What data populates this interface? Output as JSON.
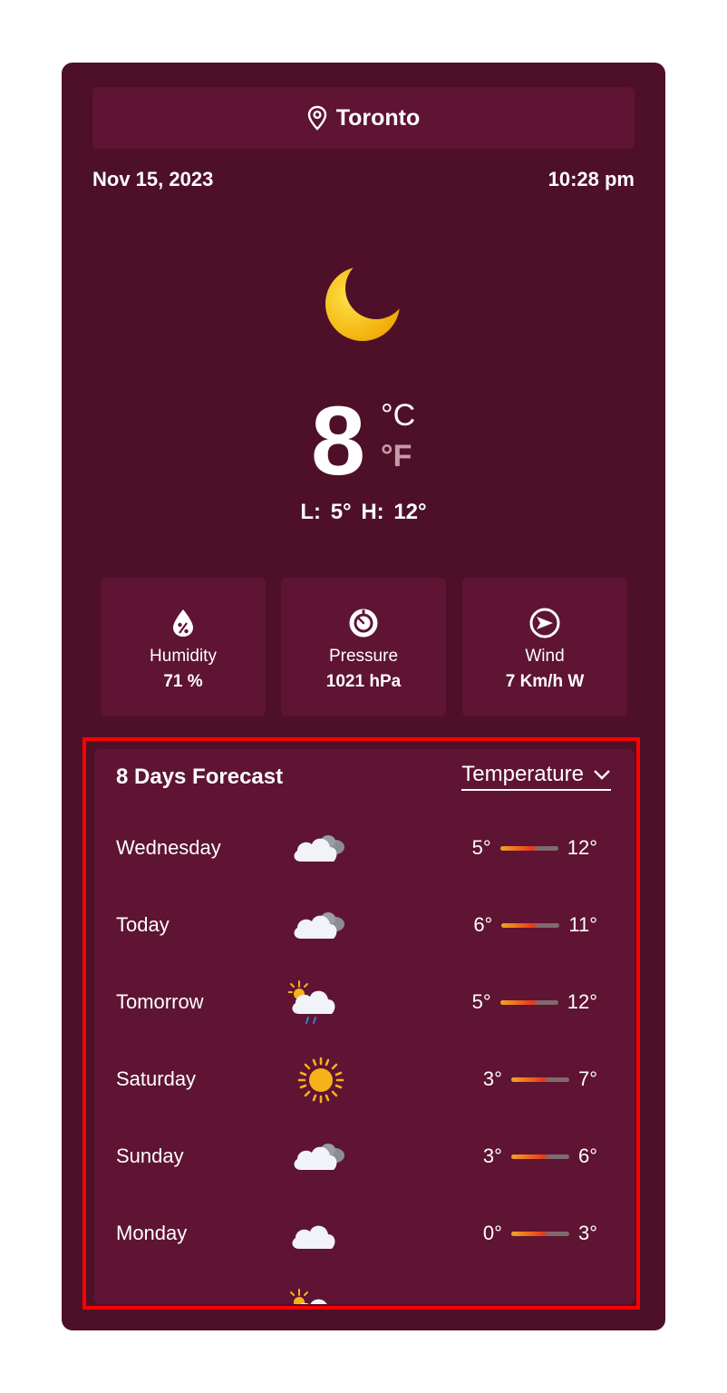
{
  "location": {
    "city": "Toronto",
    "icon": "map-pin-icon"
  },
  "date": "Nov 15, 2023",
  "time": "10:28 pm",
  "current": {
    "icon": "moon-icon",
    "temperature": "8",
    "unit_c": "°C",
    "unit_f": "°F",
    "low_high": "L: 5°  H: 12°"
  },
  "stats": [
    {
      "label": "Humidity",
      "value": "71 %",
      "icon": "humidity-drop-icon"
    },
    {
      "label": "Pressure",
      "value": "1021 hPa",
      "icon": "pressure-gauge-icon"
    },
    {
      "label": "Wind",
      "value": "7 Km/h W",
      "icon": "wind-direction-icon"
    }
  ],
  "forecast": {
    "title": "8 Days Forecast",
    "metric": "Temperature",
    "days": [
      {
        "day": "Wednesday",
        "icon": "cloud-icon",
        "low": "5°",
        "high": "12°"
      },
      {
        "day": "Today",
        "icon": "cloud-icon",
        "low": "6°",
        "high": "11°"
      },
      {
        "day": "Tomorrow",
        "icon": "sun-cloud-rain-icon",
        "low": "5°",
        "high": "12°"
      },
      {
        "day": "Saturday",
        "icon": "sun-icon",
        "low": "3°",
        "high": "7°"
      },
      {
        "day": "Sunday",
        "icon": "cloud-icon",
        "low": "3°",
        "high": "6°"
      },
      {
        "day": "Monday",
        "icon": "cloud-icon",
        "low": "0°",
        "high": "3°"
      }
    ]
  },
  "colors": {
    "card_bg": "#4e1029",
    "panel_bg": "#5e1432",
    "accent_orange": "#f2a623",
    "accent_red": "#e63a18",
    "highlight_border": "#ff0000"
  }
}
